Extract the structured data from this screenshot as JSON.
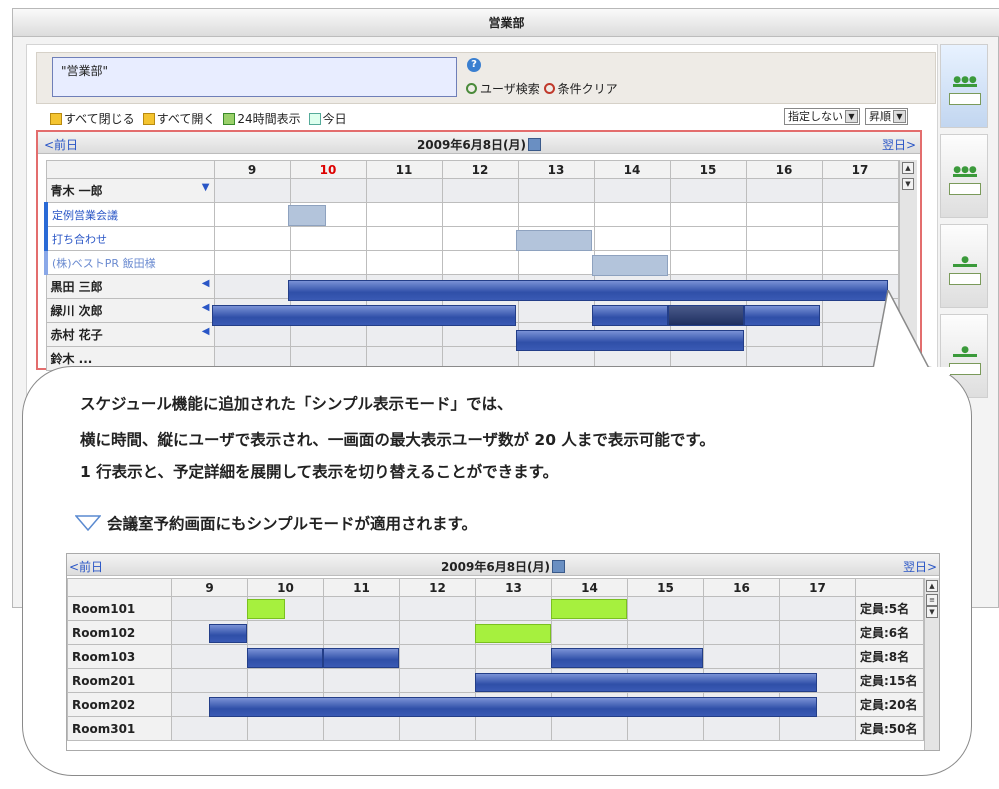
{
  "window_title": "営業部",
  "search": {
    "value": "\"営業部\"",
    "user_search": "ユーザ検索",
    "clear": "条件クリア",
    "help": "?"
  },
  "toolbar": {
    "collapse_all": "すべて閉じる",
    "expand_all": "すべて開く",
    "hours24": "24時間表示",
    "today": "今日",
    "sort_field": "指定しない",
    "sort_order": "昇順"
  },
  "schedule": {
    "prev": "<前日",
    "next": "翌日>",
    "date": "2009年6月8日(月)",
    "hours": [
      "9",
      "10",
      "11",
      "12",
      "13",
      "14",
      "15",
      "16",
      "17"
    ],
    "current_hour": "10",
    "rows": [
      {
        "name": "青木 一郎",
        "toggle": "▼"
      },
      {
        "name": "定例営業会議",
        "sub": true
      },
      {
        "name": "打ち合わせ",
        "sub": true
      },
      {
        "name": "(株)ベストPR 飯田様",
        "sub": true
      },
      {
        "name": "黒田 三郎",
        "toggle": "◀"
      },
      {
        "name": "緑川 次郎",
        "toggle": "◀"
      },
      {
        "name": "赤村 花子",
        "toggle": "◀"
      },
      {
        "name": "鈴木 ..."
      }
    ]
  },
  "callout": {
    "line1": "スケジュール機能に追加された「シンプル表示モード」では、",
    "line2": "横に時間、縦にユーザで表示され、一画面の最大表示ユーザ数が 20 人まで表示可能です。",
    "line3": "1 行表示と、予定詳細を展開して表示を切り替えることができます。",
    "subhead": "会議室予約画面にもシンプルモードが適用されます。"
  },
  "rooms": {
    "prev": "<前日",
    "next": "翌日>",
    "date": "2009年6月8日(月)",
    "hours": [
      "9",
      "10",
      "11",
      "12",
      "13",
      "14",
      "15",
      "16",
      "17"
    ],
    "list": [
      {
        "name": "Room101",
        "cap": "定員:5名"
      },
      {
        "name": "Room102",
        "cap": "定員:6名"
      },
      {
        "name": "Room103",
        "cap": "定員:8名"
      },
      {
        "name": "Room201",
        "cap": "定員:15名"
      },
      {
        "name": "Room202",
        "cap": "定員:20名"
      },
      {
        "name": "Room301",
        "cap": "定員:50名"
      }
    ]
  },
  "colors": {
    "accent_red": "#e36d6d",
    "bar_blue": "#2f4fa8",
    "lime": "#a6f03e",
    "link_blue": "#2a56c6"
  }
}
